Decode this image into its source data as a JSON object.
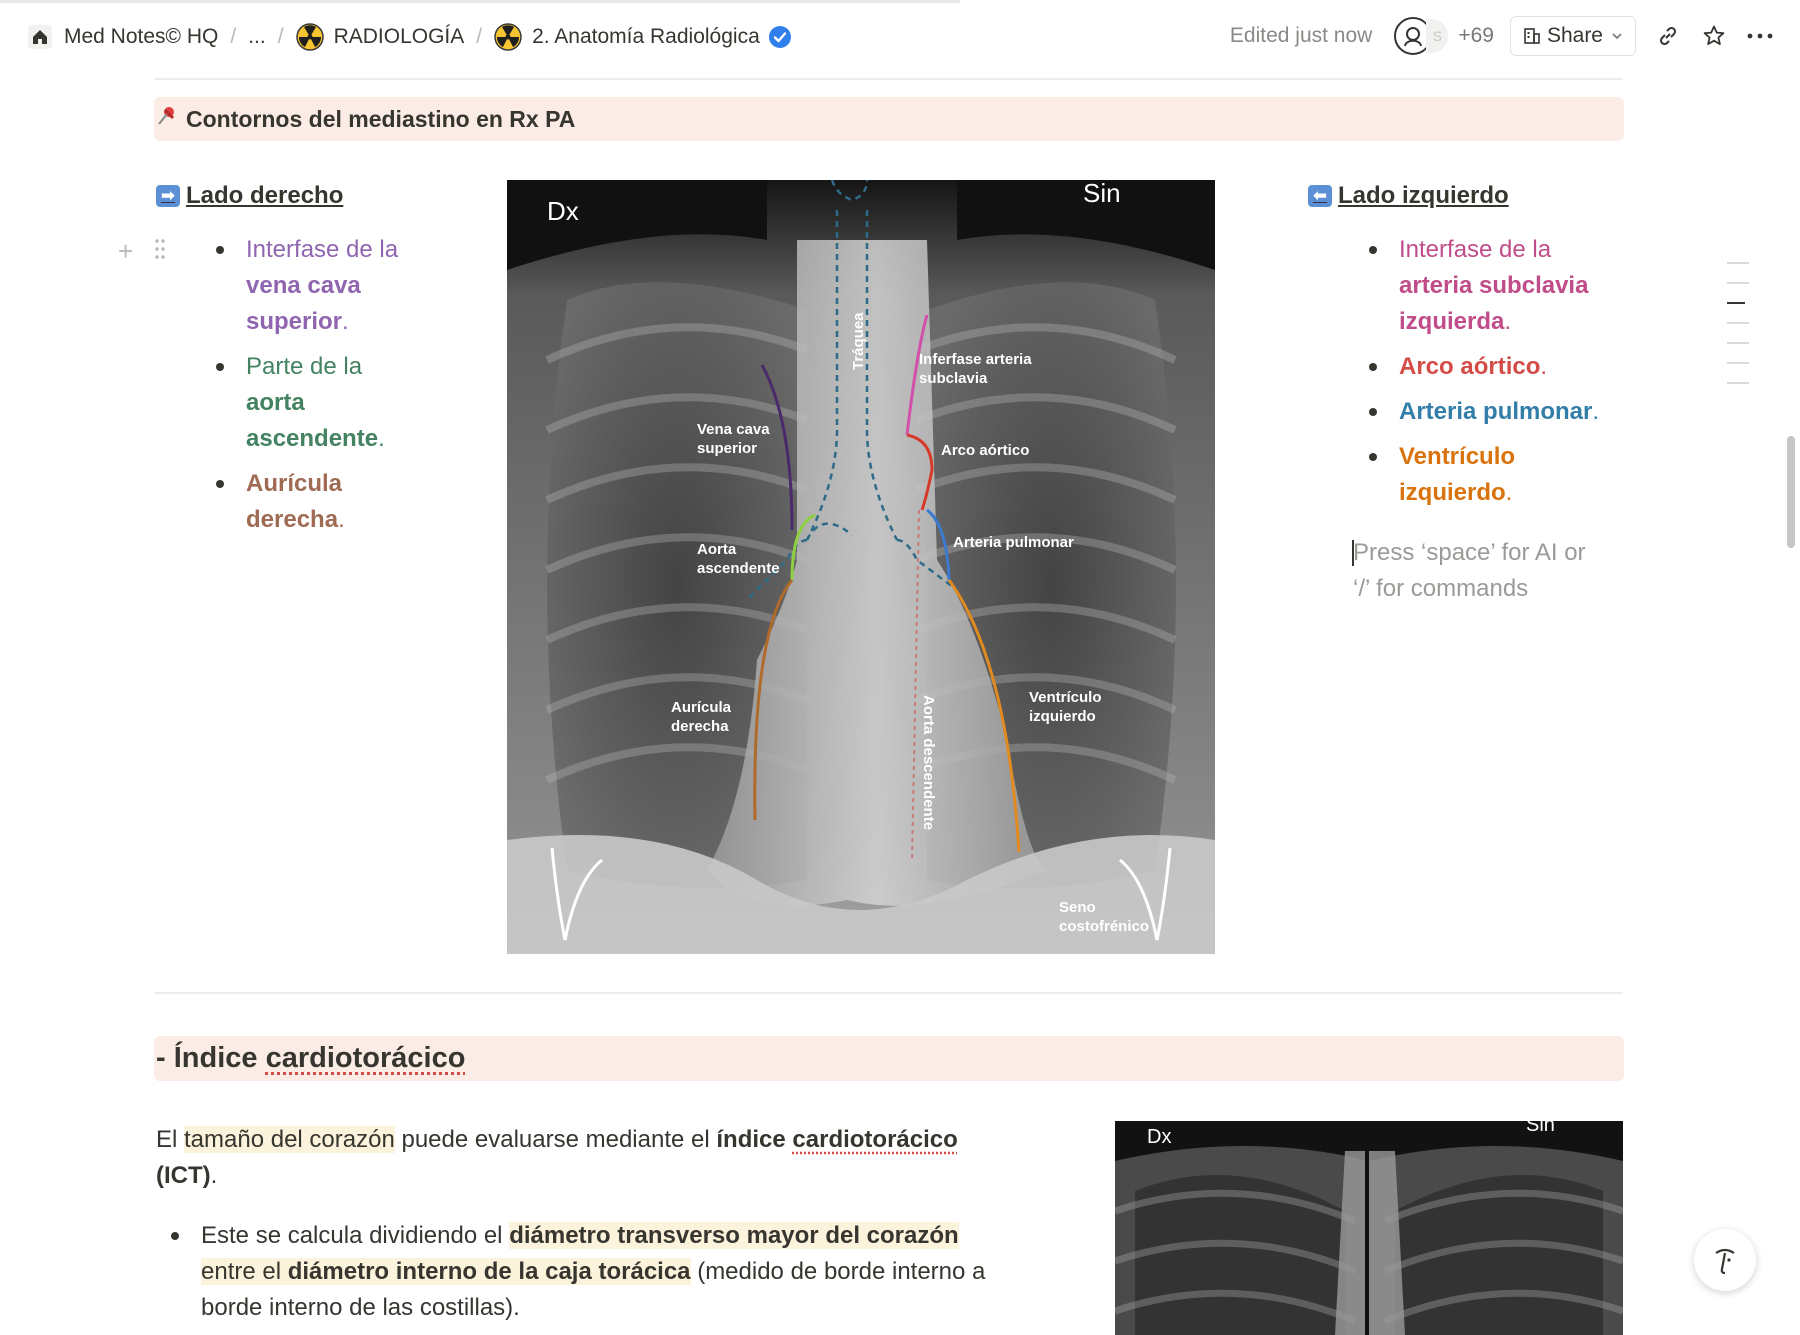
{
  "breadcrumb": {
    "workspace": "Med Notes© HQ",
    "ellipsis": "...",
    "section": "RADIOLOGÍA",
    "page": "2. Anatomía Radiológica"
  },
  "topbar": {
    "edited": "Edited just now",
    "avatar_initial": "S",
    "collaborators_count": "+69",
    "share_label": "Share"
  },
  "callout_mediastinum": {
    "title": "Contornos del mediastino en Rx PA"
  },
  "right_side": {
    "heading": "Lado derecho",
    "items": [
      {
        "pre": "Interfase de la ",
        "bold": "vena cava superior",
        "post": "."
      },
      {
        "pre": "Parte de la ",
        "bold": "aorta ascendente",
        "post": "."
      },
      {
        "pre": "",
        "bold": "Aurícula derecha",
        "post": "."
      }
    ]
  },
  "left_side": {
    "heading": "Lado izquierdo",
    "items": [
      {
        "pre": "Interfase de la ",
        "bold": "arteria subclavia izquierda",
        "post": "."
      },
      {
        "pre": "",
        "bold": "Arco aórtico",
        "post": "."
      },
      {
        "pre": "",
        "bold": "Arteria pulmonar",
        "post": "."
      },
      {
        "pre": "",
        "bold": "Ventrículo izquierdo",
        "post": "."
      }
    ],
    "placeholder": "Press ‘space’ for AI or ‘/’ for commands"
  },
  "xray_labels": {
    "dx": "Dx",
    "sin": "Sin",
    "traquea": "Tráquea",
    "interfase_subclavia": "Inferfase arteria subclavia",
    "vena_cava": "Vena cava superior",
    "arco_aortico": "Arco aórtico",
    "aorta_ascendente": "Aorta ascendente",
    "arteria_pulmonar": "Arteria pulmonar",
    "auricula": "Aurícula derecha",
    "aorta_descendente": "Aorta descendente",
    "ventriculo": "Ventrículo izquierdo",
    "seno": "Seno costofrénico"
  },
  "callout_ict": {
    "title_prefix": "- Índice ",
    "title_word": "cardiotorácico"
  },
  "ict_paragraph": {
    "p1": "El ",
    "hl1": "tamaño del corazón",
    "p2": " puede evaluarse mediante el ",
    "b1": "índice ",
    "b2": "cardiotorácico",
    "b3": "(ICT)",
    "p3": "."
  },
  "ict_bullet": {
    "p1": "Este se calcula dividiendo el ",
    "hl1": "diámetro transverso mayor del corazón",
    "p2": "entre el ",
    "hl2": "diámetro interno de la caja torácica",
    "p3": " (medido de borde interno a borde interno de las costillas)."
  },
  "xray2_labels": {
    "dx": "Dx",
    "sin": "Sin"
  },
  "colors": {
    "callout_bg": "#fbece6",
    "purple": "#9065b0",
    "green": "#448361",
    "brown": "#9f6b53",
    "pink": "#c14c8a",
    "red": "#d44c47",
    "blue": "#337ea9",
    "orange": "#d9730d"
  }
}
